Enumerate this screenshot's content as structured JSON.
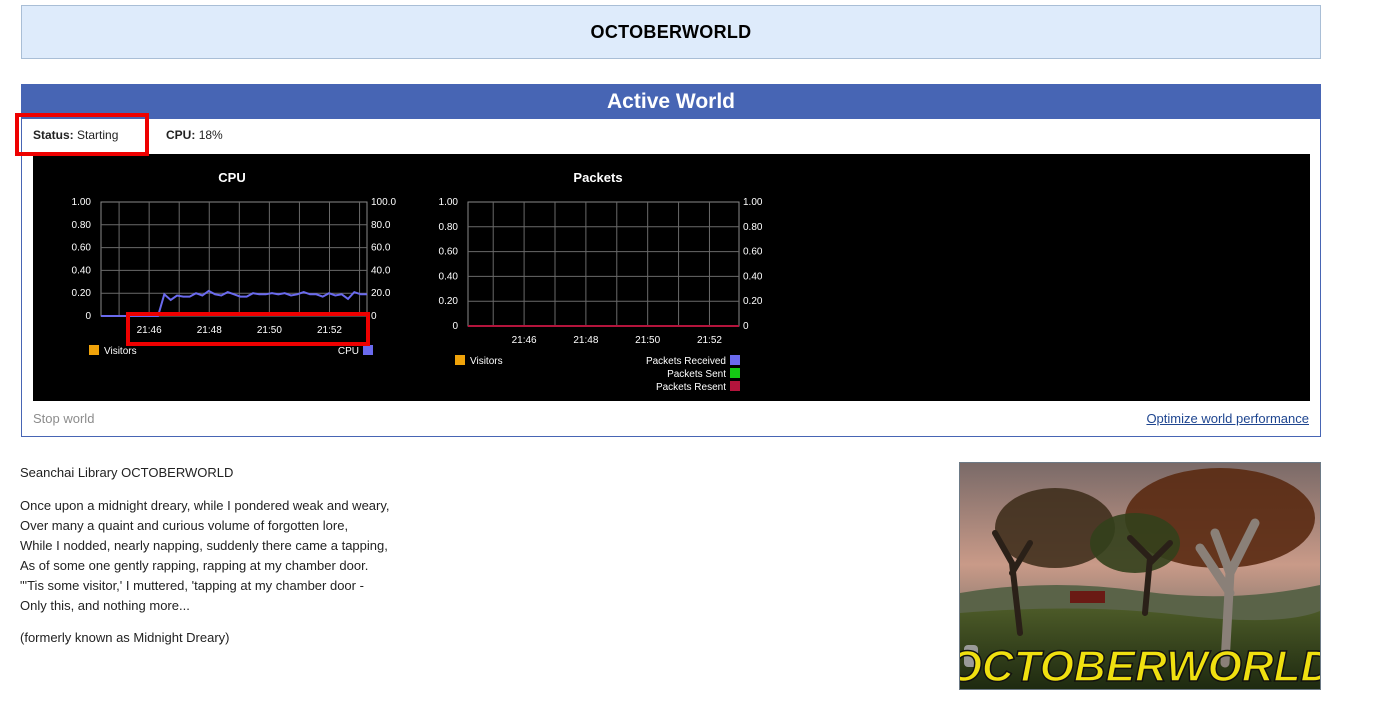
{
  "header": {
    "title": "OCTOBERWORLD"
  },
  "panel": {
    "title": "Active World",
    "status_label": "Status:",
    "status_value": "Starting",
    "cpu_label": "CPU:",
    "cpu_value": "18%",
    "stop_label": "Stop world",
    "optimize_label": "Optimize world performance"
  },
  "charts": {
    "cpu": {
      "title": "CPU",
      "legend_left": "Visitors",
      "legend_right": "CPU"
    },
    "packets": {
      "title": "Packets",
      "legend_left": "Visitors",
      "legend_right": [
        "Packets Received",
        "Packets Sent",
        "Packets Resent"
      ]
    }
  },
  "chart_data": [
    {
      "type": "line",
      "title": "CPU",
      "x_ticks": [
        "21:46",
        "21:48",
        "21:50",
        "21:52"
      ],
      "y_left_ticks": [
        "1.00",
        "0.80",
        "0.60",
        "0.40",
        "0.20",
        "0"
      ],
      "y_right_ticks": [
        "100.0",
        "80.0",
        "60.0",
        "40.0",
        "20.0",
        "0"
      ],
      "ylim_left": [
        0,
        1
      ],
      "ylim_right": [
        0,
        100
      ],
      "series": [
        {
          "name": "Visitors",
          "color": "#f0a30a",
          "axis": "left",
          "values": []
        },
        {
          "name": "CPU",
          "color": "#6a6aee",
          "axis": "right",
          "values": [
            0,
            0,
            0,
            0,
            0,
            0,
            0,
            0,
            0,
            0,
            19,
            14,
            18,
            17,
            17,
            20,
            18,
            22,
            19,
            18,
            21,
            19,
            17,
            17,
            20,
            19,
            19,
            20,
            19,
            20,
            18,
            19,
            21,
            19,
            19,
            17,
            20,
            18,
            19,
            15,
            21,
            19,
            19
          ]
        }
      ],
      "grid": true
    },
    {
      "type": "line",
      "title": "Packets",
      "x_ticks": [
        "21:46",
        "21:48",
        "21:50",
        "21:52"
      ],
      "y_left_ticks": [
        "1.00",
        "0.80",
        "0.60",
        "0.40",
        "0.20",
        "0"
      ],
      "y_right_ticks": [
        "1.00",
        "0.80",
        "0.60",
        "0.40",
        "0.20",
        "0"
      ],
      "ylim_left": [
        0,
        1
      ],
      "ylim_right": [
        0,
        1
      ],
      "series": [
        {
          "name": "Visitors",
          "color": "#f0a30a",
          "values": [
            0,
            0,
            0,
            0,
            0,
            0,
            0,
            0,
            0,
            0,
            0,
            0,
            0,
            0
          ]
        },
        {
          "name": "Packets Received",
          "color": "#6a6aee",
          "values": [
            0,
            0,
            0,
            0,
            0,
            0,
            0,
            0,
            0,
            0,
            0,
            0,
            0,
            0
          ]
        },
        {
          "name": "Packets Sent",
          "color": "#14c814",
          "values": [
            0,
            0,
            0,
            0,
            0,
            0,
            0,
            0,
            0,
            0,
            0,
            0,
            0,
            0
          ]
        },
        {
          "name": "Packets Resent",
          "color": "#b4143c",
          "values": [
            0,
            0,
            0,
            0,
            0,
            0,
            0,
            0,
            0,
            0,
            0,
            0,
            0,
            0
          ]
        }
      ],
      "grid": true
    }
  ],
  "description": {
    "subtitle": "Seanchai Library OCTOBERWORLD",
    "poem": [
      "Once upon a midnight dreary, while I pondered weak and weary,",
      "Over many a quaint and curious volume of forgotten lore,",
      "While I nodded, nearly napping, suddenly there came a tapping,",
      "As of some one gently rapping, rapping at my chamber door.",
      "\"'Tis some visitor,' I muttered, 'tapping at my chamber door -",
      "Only this, and nothing more..."
    ],
    "note": "(formerly known as Midnight Dreary)"
  },
  "thumbnail": {
    "caption": "OCTOBERWORLD"
  }
}
